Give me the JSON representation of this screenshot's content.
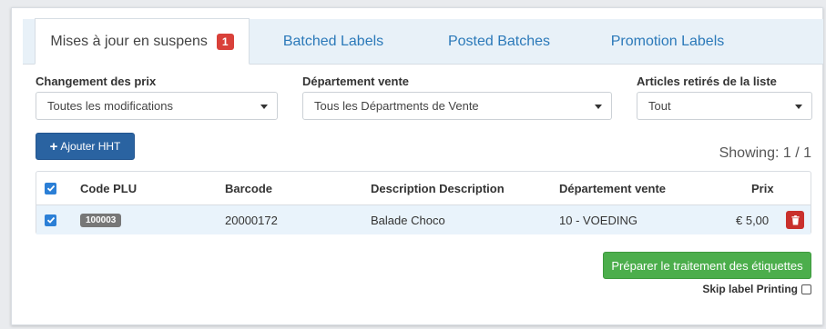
{
  "tabs": [
    {
      "label": "Mises à jour en suspens",
      "badge": "1",
      "active": true
    },
    {
      "label": "Batched Labels"
    },
    {
      "label": "Posted Batches"
    },
    {
      "label": "Promotion Labels"
    }
  ],
  "filters": {
    "price_change": {
      "label": "Changement des prix",
      "value": "Toutes les modifications"
    },
    "department": {
      "label": "Département vente",
      "value": "Tous les Départments de Vente"
    },
    "removed": {
      "label": "Articles retirés de la liste",
      "value": "Tout"
    }
  },
  "add_button": "Ajouter HHT",
  "showing": "Showing: 1 / 1",
  "table": {
    "headers": {
      "code": "Code PLU",
      "barcode": "Barcode",
      "description": "Description Description",
      "department": "Département vente",
      "price": "Prix"
    },
    "rows": [
      {
        "plu": "100003",
        "barcode": "20000172",
        "description": "Balade Choco",
        "department": "10 - VOEDING",
        "price": "€ 5,00"
      }
    ]
  },
  "prepare_button": "Préparer le traitement des étiquettes",
  "skip_label": "Skip label Printing",
  "colors": {
    "tab_link": "#2b79b9",
    "badge": "#d9413a",
    "primary": "#2a63a1",
    "success": "#4cae4c",
    "danger": "#c9302c",
    "checkbox": "#2b7fd6"
  }
}
